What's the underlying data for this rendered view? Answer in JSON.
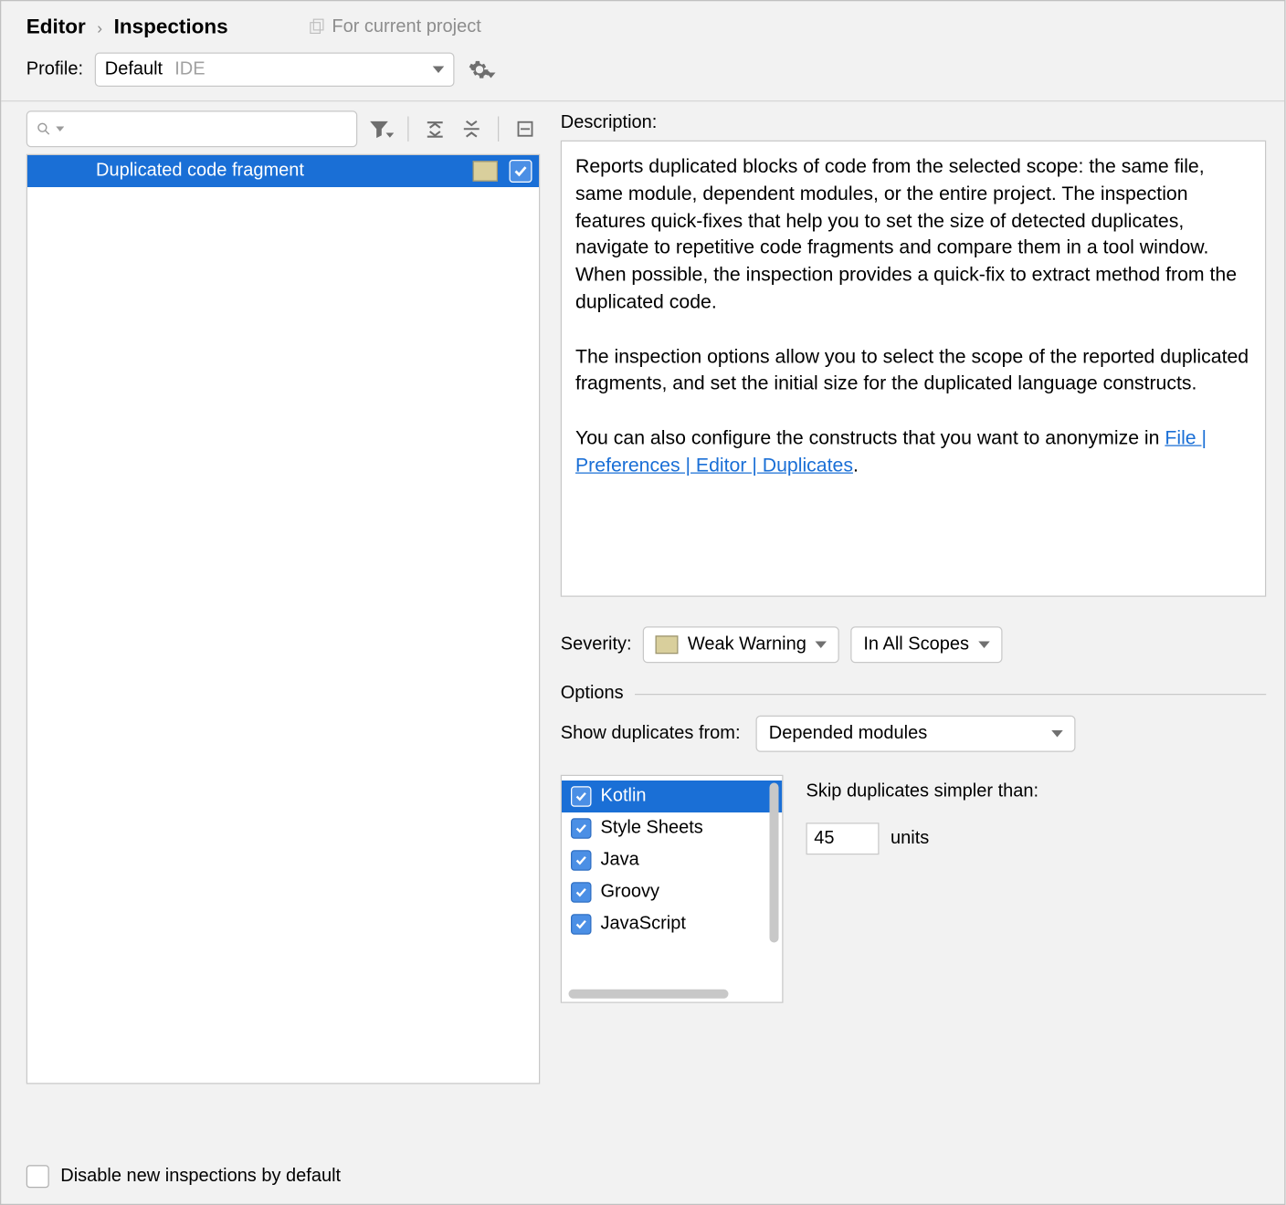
{
  "breadcrumb": {
    "editor": "Editor",
    "inspections": "Inspections",
    "for_project": "For current project"
  },
  "profile": {
    "label": "Profile:",
    "selected": "Default",
    "badge": "IDE"
  },
  "tree": {
    "item_label": "Duplicated code fragment"
  },
  "description": {
    "label": "Description:",
    "p1": "Reports duplicated blocks of code from the selected scope: the same file, same module, dependent modules, or the entire project. The inspection features quick-fixes that help you to set the size of detected duplicates, navigate to repetitive code fragments and compare them in a tool window. When possible, the inspection provides a quick-fix to extract method from the duplicated code.",
    "p2": "The inspection options allow you to select the scope of the reported duplicated fragments, and set the initial size for the duplicated language constructs.",
    "p3_pre": "You can also configure the constructs that you want to anonymize in ",
    "p3_link": "File | Preferences | Editor | Duplicates",
    "p3_post": "."
  },
  "severity": {
    "label": "Severity:",
    "value": "Weak Warning",
    "scope": "In All Scopes"
  },
  "options": {
    "heading": "Options",
    "show_dup_label": "Show duplicates from:",
    "show_dup_value": "Depended modules"
  },
  "languages": {
    "items": [
      {
        "label": "Kotlin",
        "checked": true,
        "selected": true
      },
      {
        "label": "Style Sheets",
        "checked": true,
        "selected": false
      },
      {
        "label": "Java",
        "checked": true,
        "selected": false
      },
      {
        "label": "Groovy",
        "checked": true,
        "selected": false
      },
      {
        "label": "JavaScript",
        "checked": true,
        "selected": false
      }
    ]
  },
  "skip": {
    "label": "Skip duplicates simpler than:",
    "value": "45",
    "units": "units"
  },
  "footer": {
    "disable_label": "Disable new inspections by default"
  }
}
